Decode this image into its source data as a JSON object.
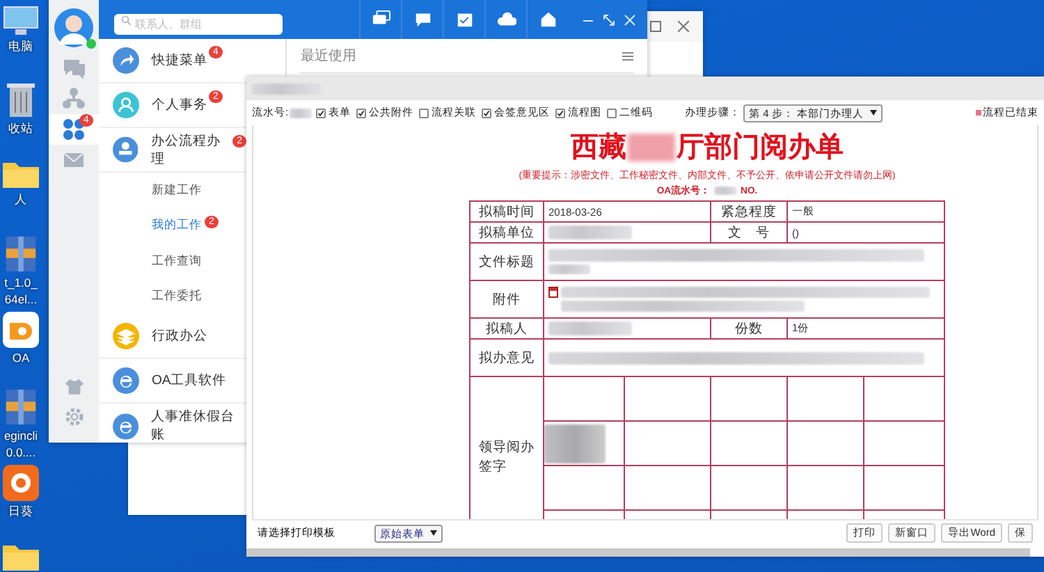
{
  "desktop_icons": [
    {
      "kind": "computer",
      "lines": [
        "电脑"
      ]
    },
    {
      "kind": "recycle",
      "lines": [
        "收站"
      ]
    },
    {
      "kind": "folder",
      "lines": [
        "人"
      ]
    },
    {
      "kind": "archive",
      "lines": [
        "t_1.0_",
        "64el..."
      ]
    },
    {
      "kind": "orange-app",
      "lines": [
        "OA"
      ]
    },
    {
      "kind": "archive",
      "lines": [
        "egincli",
        "0.0...."
      ]
    },
    {
      "kind": "sun-app",
      "lines": [
        "日葵"
      ]
    },
    {
      "kind": "folder"
    }
  ],
  "chat_window": {
    "search": {
      "placeholder": "联系人、群组"
    },
    "rail": [
      {
        "kind": "chat",
        "selected": false
      },
      {
        "kind": "org",
        "selected": false
      },
      {
        "kind": "apps",
        "selected": true,
        "badge": "4"
      },
      {
        "kind": "mail",
        "selected": false
      }
    ],
    "rail_bottom": [
      {
        "kind": "skin"
      },
      {
        "kind": "settings"
      }
    ],
    "header_icons": [
      {
        "kind": "chat"
      },
      {
        "kind": "comment"
      },
      {
        "kind": "calendar"
      },
      {
        "kind": "cloud"
      },
      {
        "kind": "home"
      }
    ],
    "menu": [
      {
        "label": "快捷菜单",
        "kind": "share",
        "badge": "4"
      },
      {
        "label": "个人事务",
        "kind": "person",
        "badge": "2"
      },
      {
        "label": "办公流程办理",
        "kind": "stamp",
        "badge": "2",
        "children": [
          {
            "label": "新建工作",
            "selected": false
          },
          {
            "label": "我的工作",
            "selected": true,
            "badge": "2"
          },
          {
            "label": "工作查询",
            "selected": false
          },
          {
            "label": "工作委托",
            "selected": false
          }
        ]
      },
      {
        "label": "行政办公",
        "kind": "layers"
      },
      {
        "label": "OA工具软件",
        "kind": "browser"
      },
      {
        "label": "人事准休假台账",
        "kind": "browser"
      }
    ],
    "recent": {
      "title": "最近使用"
    }
  },
  "form_window": {
    "toolbar": {
      "serial_label": "流水号:",
      "options": [
        {
          "label": "表单",
          "checked": true
        },
        {
          "label": "公共附件",
          "checked": true
        },
        {
          "label": "流程关联",
          "checked": false
        },
        {
          "label": "会签意见区",
          "checked": true
        },
        {
          "label": "流程图",
          "checked": true
        },
        {
          "label": "二维码",
          "checked": false
        }
      ],
      "step_label": "办理步骤：",
      "step_value": "第 4 步： 本部门办理人",
      "status": "流程已结束"
    },
    "doc": {
      "title_left": "西藏",
      "title_right": "厅部门阅办单",
      "notice": "(重要提示：涉密文件、工作秘密文件、内部文件、不予公开、依申请公开文件请勿上网)",
      "serial_label": "OA流水号：",
      "serial_suffix": "NO.",
      "rows": [
        {
          "kind": "pair",
          "label": "拟稿时间",
          "value": "2018-03-26",
          "label2": "紧急程度",
          "value2": "一般"
        },
        {
          "kind": "pair",
          "label": "拟稿单位",
          "redacted": true,
          "label2": "文　号",
          "value2": "()"
        },
        {
          "kind": "wide",
          "label": "文件标题",
          "redacted": true
        },
        {
          "kind": "attachment",
          "label": "附件",
          "redacted": true
        },
        {
          "kind": "pair",
          "label": "拟稿人",
          "redacted": true,
          "label2": "份数",
          "value2": "1份"
        },
        {
          "kind": "wide",
          "label": "拟办意见",
          "redacted": true
        },
        {
          "kind": "grid",
          "label": "领导阅办签字",
          "redacted": true
        }
      ]
    },
    "bottom": {
      "template_label": "请选择打印模板",
      "template_value": "原始表单",
      "buttons": [
        "打印",
        "新窗口",
        "导出Word",
        "保"
      ]
    }
  }
}
